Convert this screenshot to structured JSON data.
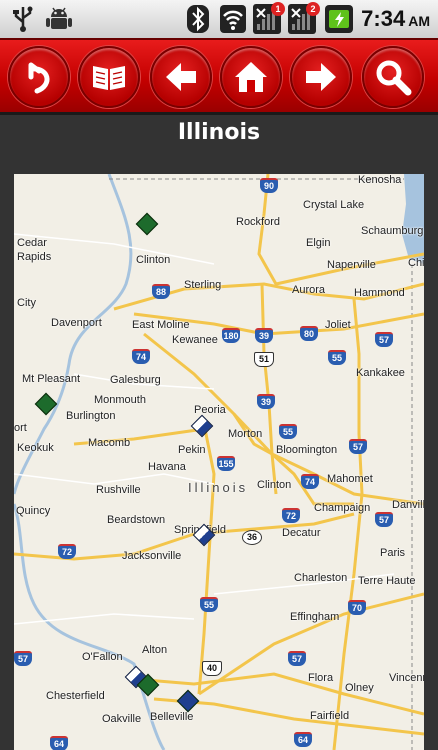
{
  "status_bar": {
    "time": "7:34",
    "ampm": "AM",
    "signal_badges": [
      "1",
      "2"
    ],
    "icons": [
      "usb-icon",
      "android-debug-icon",
      "bluetooth-icon",
      "wifi-icon",
      "signal-icon",
      "signal-icon",
      "battery-charging-icon"
    ]
  },
  "toolbar": {
    "buttons": [
      "back-icon",
      "book-icon",
      "arrow-left-icon",
      "home-icon",
      "arrow-right-icon",
      "search-icon"
    ]
  },
  "page": {
    "title": "Illinois"
  },
  "map": {
    "state_label": "Illinois",
    "cities": [
      "Kenosha",
      "Crystal Lake",
      "Rockford",
      "Elgin",
      "Schaumburg",
      "Cedar",
      "Rapids",
      "Clinton",
      "Sterling",
      "Aurora",
      "Naperville",
      "Chi",
      "Hammond",
      "City",
      "Davenport",
      "East Moline",
      "Kewanee",
      "Joliet",
      "Mt Pleasant",
      "Galesburg",
      "Monmouth",
      "Burlington",
      "Kankakee",
      "Peoria",
      "Morton",
      "ort",
      "Keokuk",
      "Macomb",
      "Pekin",
      "Bloomington",
      "Havana",
      "Mahomet",
      "Rushville",
      "Clinton",
      "Champaign",
      "Quincy",
      "Beardstown",
      "Danville",
      "Springfield",
      "Decatur",
      "Jacksonville",
      "Paris",
      "Charleston",
      "Terre Haute",
      "Effingham",
      "O'Fallon",
      "Alton",
      "Flora",
      "Olney",
      "Vincenne",
      "Chesterfield",
      "Belleville",
      "Oakville",
      "Fairfield"
    ],
    "highways": [
      "90",
      "88",
      "180",
      "39",
      "80",
      "57",
      "74",
      "51",
      "55",
      "155",
      "72",
      "36",
      "70",
      "40",
      "64"
    ]
  }
}
